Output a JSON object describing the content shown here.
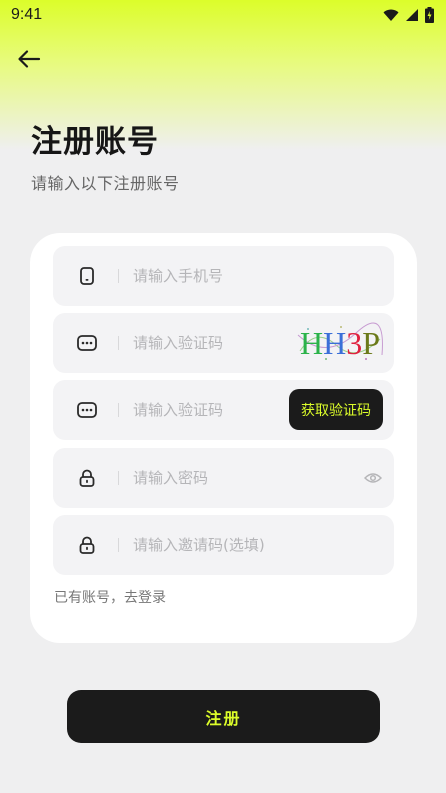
{
  "status_bar": {
    "time": "9:41"
  },
  "header": {
    "title": "注册账号",
    "subtitle": "请输入以下注册账号"
  },
  "form": {
    "phone_placeholder": "请输入手机号",
    "captcha_placeholder": "请输入验证码",
    "captcha_text": [
      "H",
      "H",
      "3",
      "P"
    ],
    "captcha_colors": [
      "#2bb34a",
      "#3a6fd8",
      "#e0213f",
      "#6b7a1a"
    ],
    "sms_code_placeholder": "请输入验证码",
    "get_code_label": "获取验证码",
    "password_placeholder": "请输入密码",
    "invite_placeholder": "请输入邀请码(选填)",
    "login_link": "已有账号，去登录"
  },
  "actions": {
    "register_label": "注册"
  },
  "theme": {
    "accent": "#dcfd2a",
    "dark": "#1b1b1b"
  }
}
